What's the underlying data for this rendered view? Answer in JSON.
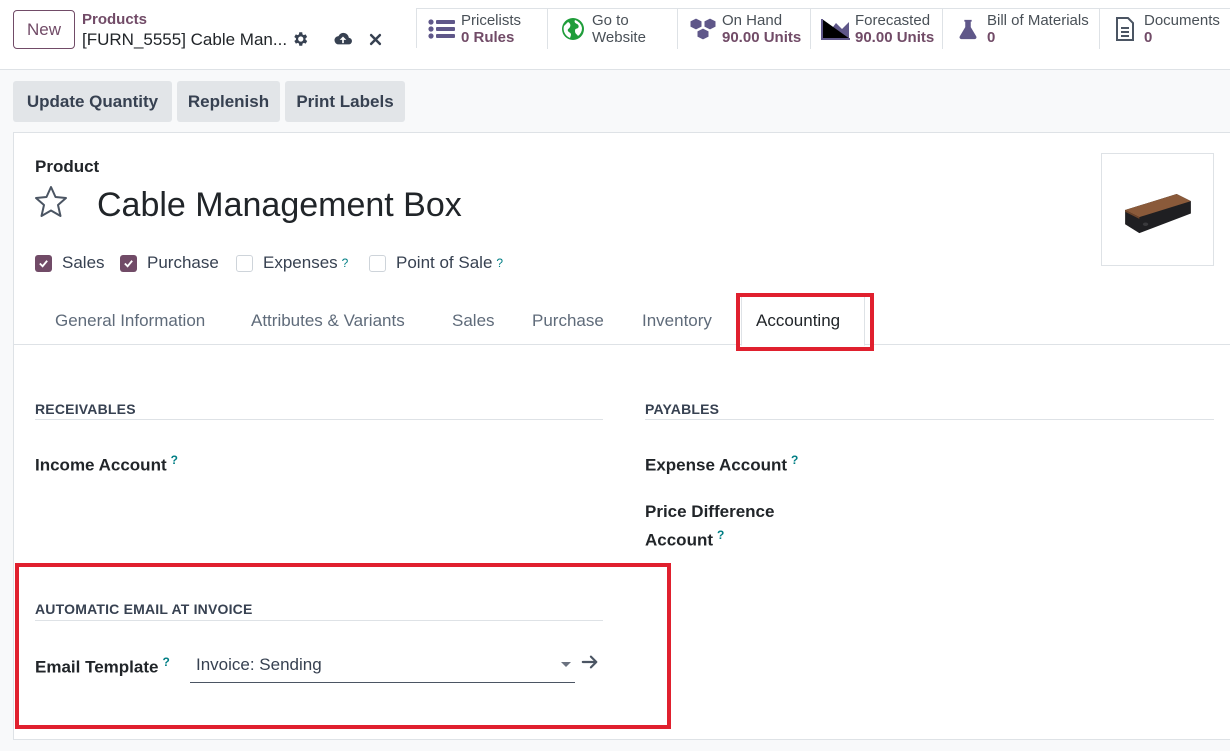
{
  "control_panel": {
    "new_label": "New",
    "breadcrumb_parent": "Products",
    "breadcrumb_current": "[FURN_5555] Cable Man...",
    "smart_buttons": [
      {
        "label": "Pricelists",
        "value": "0 Rules",
        "icon": "list-icon"
      },
      {
        "label": "Go to",
        "value": "Website",
        "icon": "globe-icon"
      },
      {
        "label": "On Hand",
        "value": "90.00 Units",
        "icon": "cubes-icon"
      },
      {
        "label": "Forecasted",
        "value": "90.00 Units",
        "icon": "area-chart-icon"
      },
      {
        "label": "Bill of Materials",
        "value": "0",
        "icon": "flask-icon"
      },
      {
        "label": "Documents",
        "value": "0",
        "icon": "file-icon"
      }
    ]
  },
  "actions": {
    "update_quantity": "Update Quantity",
    "replenish": "Replenish",
    "print_labels": "Print Labels"
  },
  "form": {
    "product_label": "Product",
    "product_name": "Cable Management Box",
    "checkboxes": [
      {
        "label": "Sales",
        "checked": true,
        "help": ""
      },
      {
        "label": "Purchase",
        "checked": true,
        "help": ""
      },
      {
        "label": "Expenses",
        "checked": false,
        "help": "?"
      },
      {
        "label": "Point of Sale",
        "checked": false,
        "help": "?"
      }
    ],
    "tabs": [
      "General Information",
      "Attributes & Variants",
      "Sales",
      "Purchase",
      "Inventory",
      "Accounting"
    ],
    "active_tab": "Accounting",
    "receivables": {
      "title": "RECEIVABLES",
      "income_account_label": "Income Account",
      "help": "?"
    },
    "payables": {
      "title": "PAYABLES",
      "expense_account_label": "Expense Account",
      "price_diff_line1": "Price Difference",
      "price_diff_line2": "Account",
      "help": "?"
    },
    "auto_email": {
      "title": "AUTOMATIC EMAIL AT INVOICE",
      "email_template_label": "Email Template",
      "email_template_value": "Invoice: Sending",
      "help": "?"
    }
  },
  "colors": {
    "brand": "#714b67",
    "highlight": "#e0202e",
    "help": "#017e84"
  }
}
